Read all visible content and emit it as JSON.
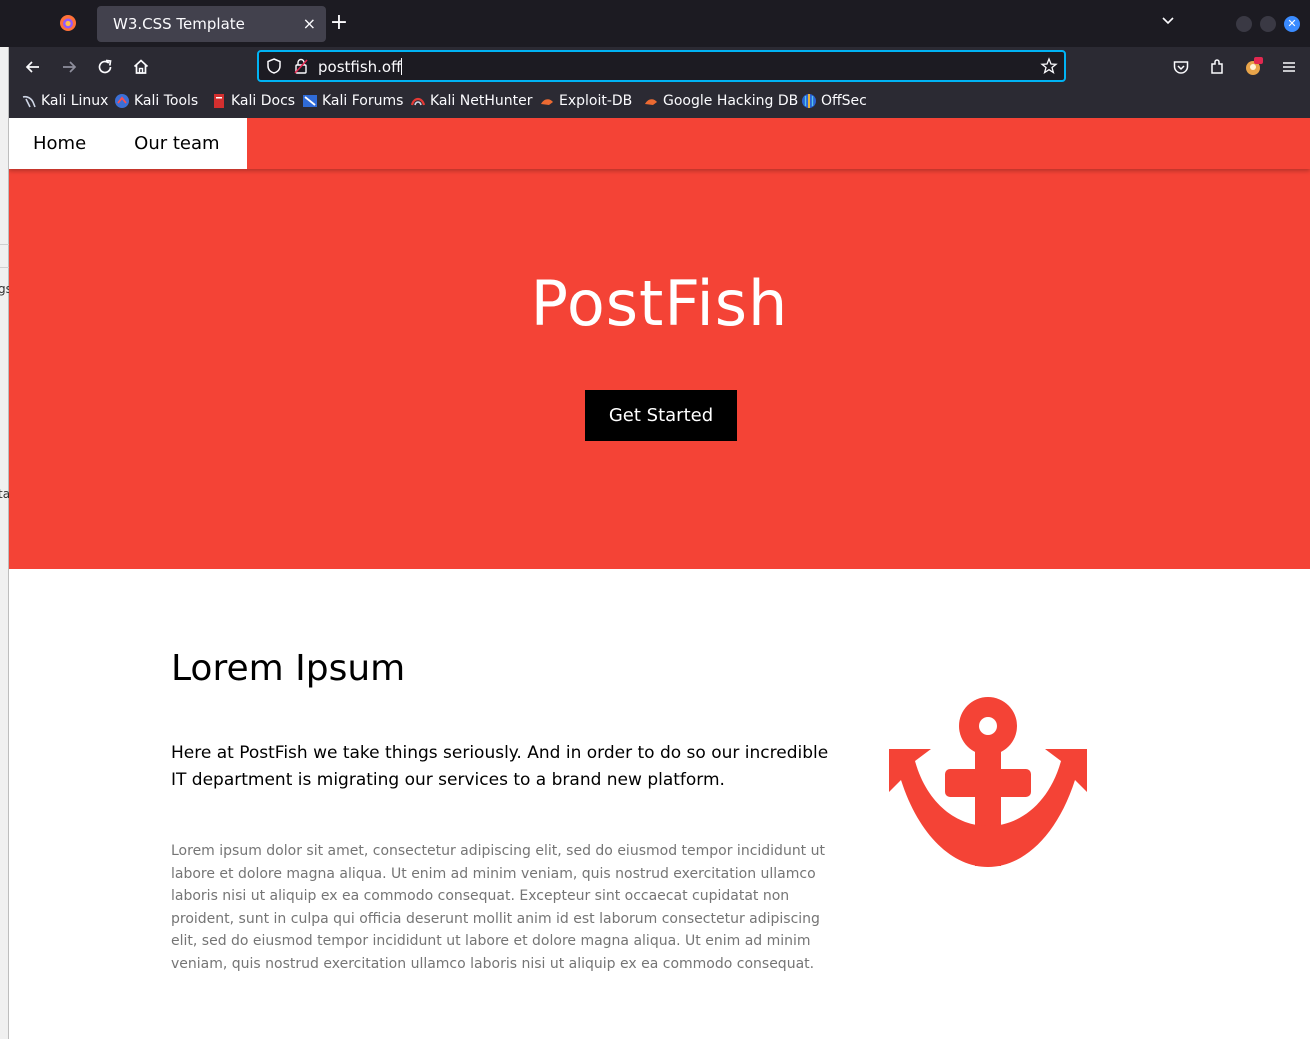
{
  "browser": {
    "tab_title": "W3.CSS Template",
    "tab_close": "×",
    "new_tab": "+",
    "url": "postfish.off",
    "bookmarks": [
      {
        "label": "Kali Linux",
        "icon": "kali-dragon-icon"
      },
      {
        "label": "Kali Tools",
        "icon": "kali-tools-icon"
      },
      {
        "label": "Kali Docs",
        "icon": "kali-docs-icon"
      },
      {
        "label": "Kali Forums",
        "icon": "kali-forums-icon"
      },
      {
        "label": "Kali NetHunter",
        "icon": "kali-nethunter-icon"
      },
      {
        "label": "Exploit-DB",
        "icon": "exploit-db-icon"
      },
      {
        "label": "Google Hacking DB",
        "icon": "ghdb-icon"
      },
      {
        "label": "OffSec",
        "icon": "offsec-icon"
      }
    ]
  },
  "site": {
    "nav": {
      "home": "Home",
      "team": "Our team"
    },
    "hero": {
      "title": "PostFish",
      "button": "Get Started"
    },
    "section": {
      "heading": "Lorem Ipsum",
      "lead": "Here at PostFish we take things seriously. And in order to do so our incredible IT department is migrating our services to a brand new platform.",
      "body": "Lorem ipsum dolor sit amet, consectetur adipiscing elit, sed do eiusmod tempor incididunt ut labore et dolore magna aliqua. Ut enim ad minim veniam, quis nostrud exercitation ullamco laboris nisi ut aliquip ex ea commodo consequat. Excepteur sint occaecat cupidatat non proident, sunt in culpa qui officia deserunt mollit anim id est laborum consectetur adipiscing elit, sed do eiusmod tempor incididunt ut labore et dolore magna aliqua. Ut enim ad minim veniam, quis nostrud exercitation ullamco laboris nisi ut aliquip ex ea commodo consequat."
    },
    "colors": {
      "accent": "#f44336",
      "button": "#000000",
      "body_text": "#757575"
    }
  }
}
